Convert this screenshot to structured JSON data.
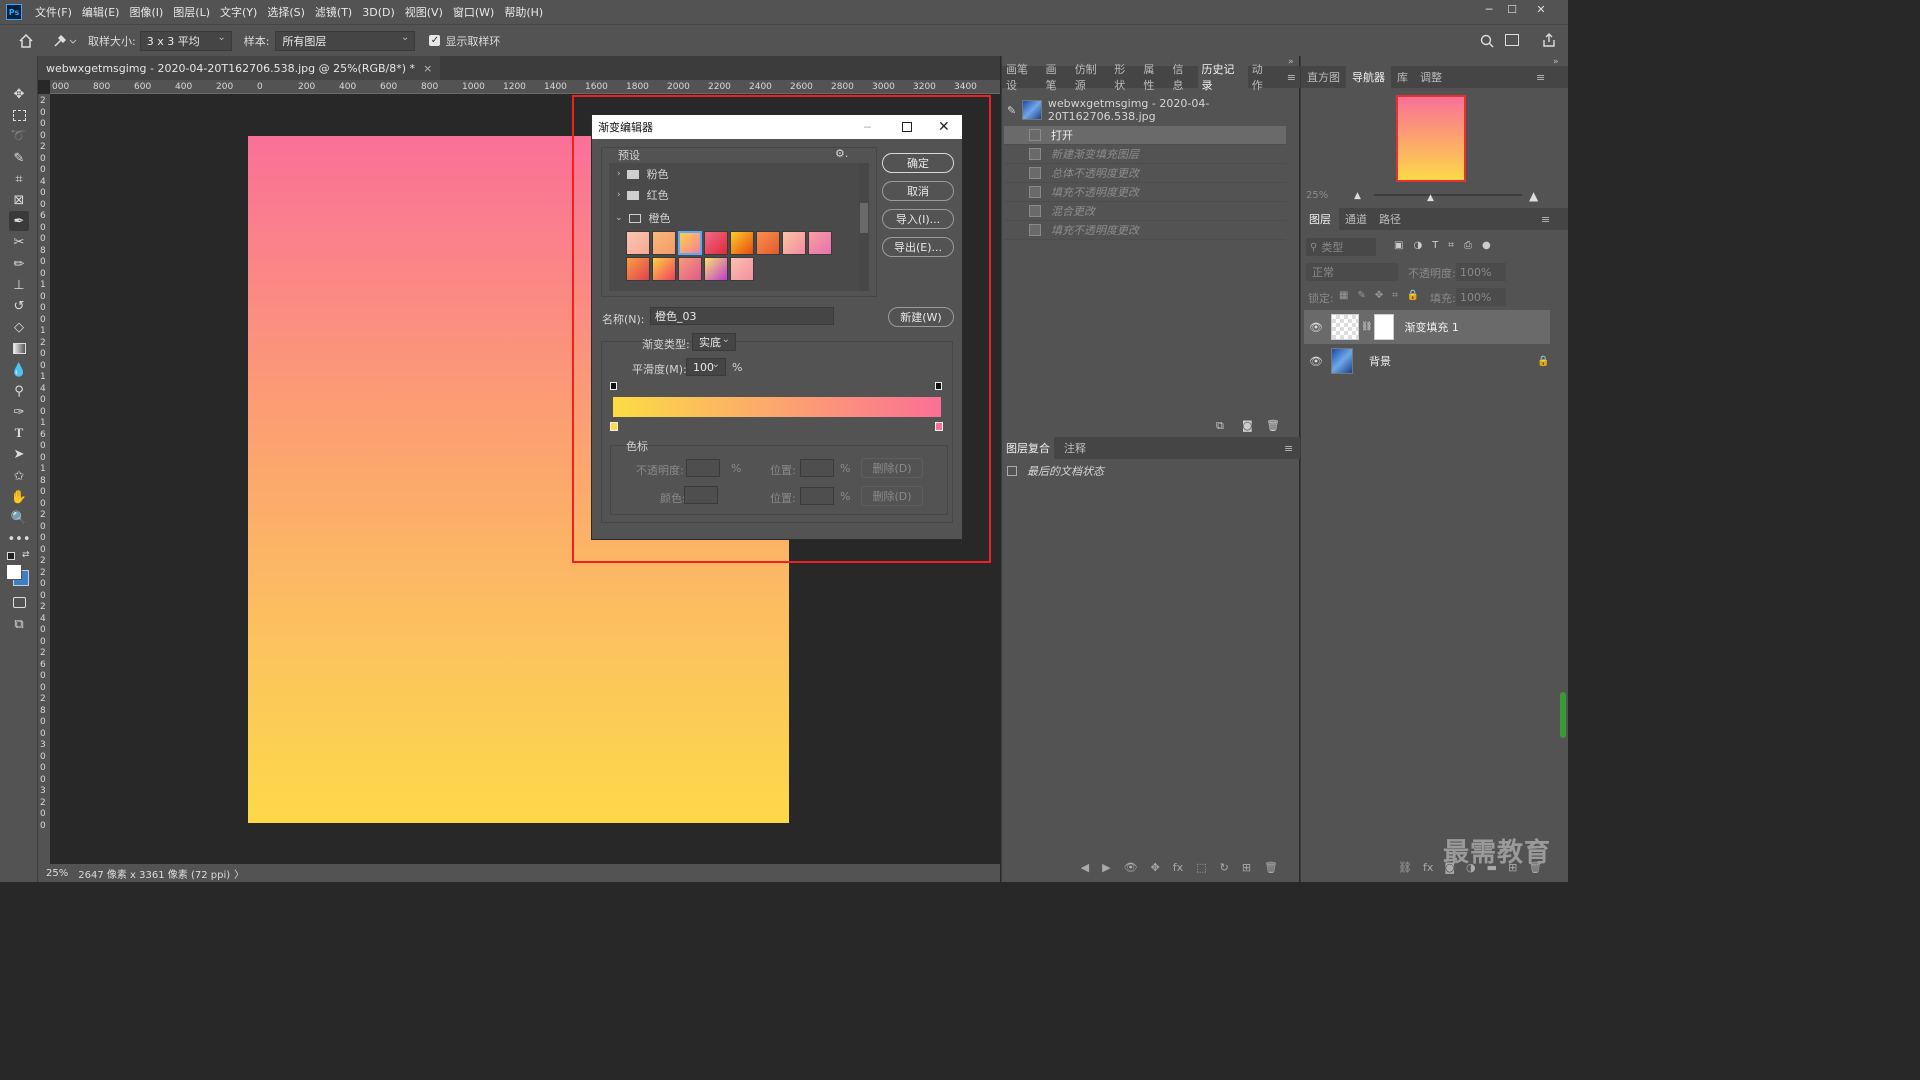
{
  "menubar": {
    "app_icon": "Ps",
    "items": [
      "文件(F)",
      "编辑(E)",
      "图像(I)",
      "图层(L)",
      "文字(Y)",
      "选择(S)",
      "滤镜(T)",
      "3D(D)",
      "视图(V)",
      "窗口(W)",
      "帮助(H)"
    ],
    "minimize": "─",
    "maximize": "☐",
    "close": "✕"
  },
  "options": {
    "sample_size_label": "取样大小:",
    "sample_size_value": "3 x 3 平均",
    "sample_label": "样本:",
    "sample_value": "所有图层",
    "show_ring_label": "显示取样环",
    "show_ring_checked": true
  },
  "document": {
    "tab_title": "webwxgetmsgimg - 2020-04-20T162706.538.jpg @ 25%(RGB/8*) *",
    "tab_close": "×",
    "ruler_h": [
      "000",
      "800",
      "600",
      "400",
      "200",
      "0",
      "200",
      "400",
      "600",
      "800",
      "1000",
      "1200",
      "1400",
      "1600",
      "1800",
      "2000",
      "2200",
      "2400",
      "2600",
      "2800",
      "3000",
      "3200",
      "3400"
    ],
    "ruler_v": [
      "2",
      "0",
      "0",
      "0",
      "2",
      "0",
      "0",
      "4",
      "0",
      "0",
      "6",
      "0",
      "0",
      "8",
      "0",
      "0",
      "1",
      "0",
      "0",
      "0",
      "1",
      "2",
      "0",
      "0",
      "1",
      "4",
      "0",
      "0",
      "1",
      "6",
      "0",
      "0",
      "1",
      "8",
      "0",
      "0",
      "2",
      "0",
      "0",
      "0",
      "2",
      "2",
      "0",
      "0",
      "2",
      "4",
      "0",
      "0",
      "2",
      "6",
      "0",
      "0",
      "2",
      "8",
      "0",
      "0",
      "3",
      "0",
      "0",
      "0",
      "3",
      "2",
      "0",
      "0"
    ],
    "zoom": "25%",
    "dimensions": "2647 像素 x 3361 像素 (72 ppi)",
    "status_arrow": "〉",
    "gradient_colors": [
      "#fa7098",
      "#fca36f",
      "#fcc45d",
      "#fdd948"
    ]
  },
  "dialog": {
    "title": "渐变编辑器",
    "presets_label": "预设",
    "gear": "⚙.",
    "folders": [
      {
        "name": "粉色",
        "expanded": false
      },
      {
        "name": "红色",
        "expanded": false
      },
      {
        "name": "橙色",
        "expanded": true
      }
    ],
    "swatches_row1": [
      "linear-gradient(135deg,#f9c4b5,#f7a990)",
      "linear-gradient(135deg,#f9b87a,#f59a6a)",
      "linear-gradient(135deg,#fdd34a,#f87c9a)",
      "linear-gradient(135deg,#f06a8a,#e0283a)",
      "linear-gradient(135deg,#fccc2a,#e84a10)",
      "linear-gradient(135deg,#f89050,#e45a2a)",
      "linear-gradient(135deg,#fcc6a4,#f48aa0)",
      "linear-gradient(135deg,#f7a0a0,#e870b0)"
    ],
    "swatches_row2": [
      "linear-gradient(135deg,#f9a040,#e04050)",
      "linear-gradient(135deg,#fdd040,#f04060)",
      "linear-gradient(135deg,#f79a7a,#e05a8a)",
      "linear-gradient(135deg,#fbe070,#c03ad0)",
      "linear-gradient(135deg,#fac0b0,#f490a0)"
    ],
    "ok": "确定",
    "cancel": "取消",
    "import": "导入(I)...",
    "export": "导出(E)...",
    "name_label": "名称(N):",
    "name_value": "橙色_03",
    "new_button": "新建(W)",
    "type_label": "渐变类型:",
    "type_value": "实底",
    "smooth_label": "平滑度(M):",
    "smooth_value": "100",
    "percent": "%",
    "stops_label": "色标",
    "opacity_label": "不透明度:",
    "location_label": "位置:",
    "delete_label": "删除(D)",
    "color_label": "颜色:",
    "bar_gradient": [
      "#fcdc44",
      "#fb6f96"
    ]
  },
  "mid_panel": {
    "tabs": [
      "画笔设",
      "画笔",
      "仿制源",
      "形状",
      "属性",
      "信息",
      "历史记录",
      "动作"
    ],
    "active_tab": "历史记录",
    "snapshot": "webwxgetmsgimg - 2020-04-20T162706.538.jpg",
    "history": [
      "打开",
      "新建渐变填充图层",
      "总体不透明度更改",
      "填充不透明度更改",
      "混合更改",
      "填充不透明度更改"
    ],
    "comps_tabs": [
      "图层复合",
      "注释"
    ],
    "comps_item": "最后的文档状态"
  },
  "right_panel": {
    "tabs": [
      "直方图",
      "导航器",
      "库",
      "调整"
    ],
    "active_tab": "导航器",
    "nav_zoom": "25%",
    "layer_tabs": [
      "图层",
      "通道",
      "路径"
    ],
    "filter_label": "类型",
    "blend_mode": "正常",
    "opacity_label": "不透明度:",
    "opacity_value": "100%",
    "lock_label": "锁定:",
    "fill_label": "填充:",
    "fill_value": "100%",
    "layers": [
      {
        "name": "渐变填充 1"
      },
      {
        "name": "背景"
      }
    ],
    "watermark": "最需教育"
  }
}
